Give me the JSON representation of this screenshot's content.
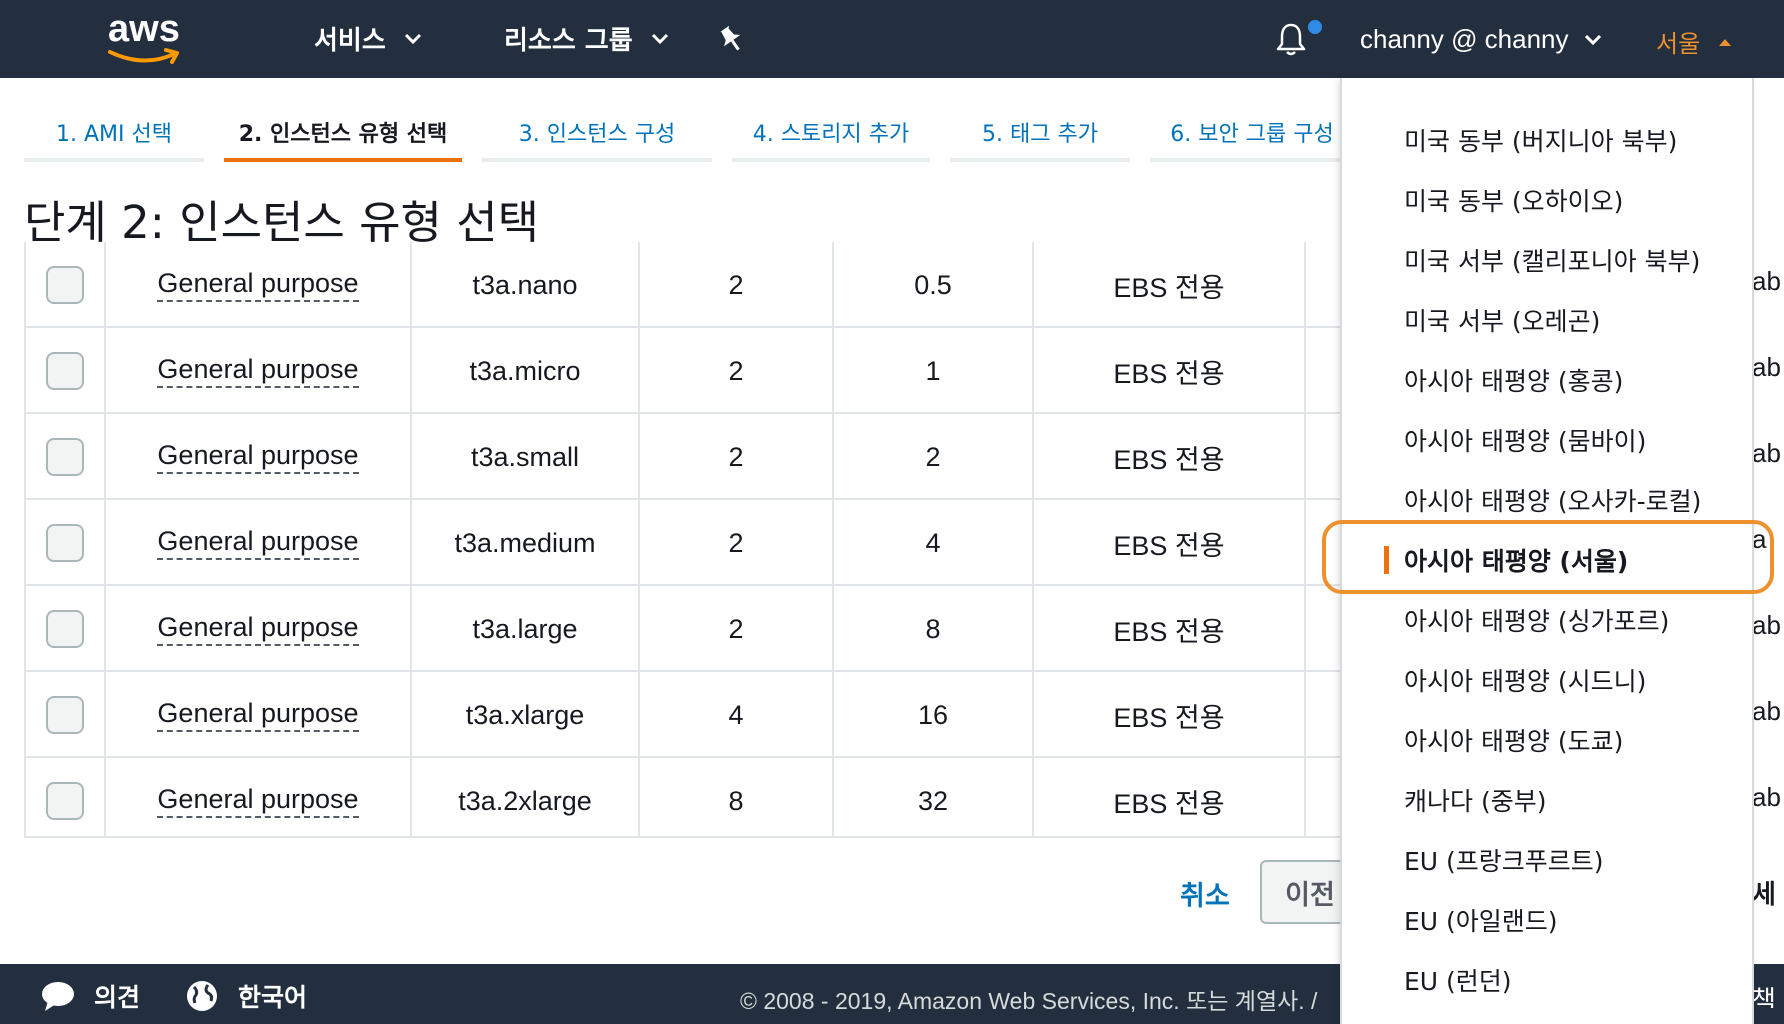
{
  "topnav": {
    "logo": "aws",
    "services_label": "서비스",
    "resource_groups_label": "리소스 그룹",
    "user_label": "channy @ channy",
    "region_label": "서울",
    "colors": {
      "background": "#232f3e",
      "region": "#ec912d",
      "notification_dot": "#2f8ce6"
    },
    "icons": [
      "chevron-down-icon",
      "pin-icon",
      "bell-icon",
      "chevron-up-icon"
    ]
  },
  "steps": [
    {
      "label": "1. AMI 선택"
    },
    {
      "label": "2. 인스턴스 유형 선택",
      "active": true
    },
    {
      "label": "3. 인스턴스 구성"
    },
    {
      "label": "4. 스토리지 추가"
    },
    {
      "label": "5. 태그 추가"
    },
    {
      "label": "6. 보안 그룹 구성"
    }
  ],
  "page_title": "단계 2: 인스턴스 유형 선택",
  "table": {
    "rows": [
      {
        "family": "General purpose",
        "type": "t3a.nano",
        "vcpus": "2",
        "memory": "0.5",
        "storage": "EBS 전용",
        "next": "ab"
      },
      {
        "family": "General purpose",
        "type": "t3a.micro",
        "vcpus": "2",
        "memory": "1",
        "storage": "EBS 전용",
        "next": "ab"
      },
      {
        "family": "General purpose",
        "type": "t3a.small",
        "vcpus": "2",
        "memory": "2",
        "storage": "EBS 전용",
        "next": "ab"
      },
      {
        "family": "General purpose",
        "type": "t3a.medium",
        "vcpus": "2",
        "memory": "4",
        "storage": "EBS 전용",
        "next": "a"
      },
      {
        "family": "General purpose",
        "type": "t3a.large",
        "vcpus": "2",
        "memory": "8",
        "storage": "EBS 전용",
        "next": "ab"
      },
      {
        "family": "General purpose",
        "type": "t3a.xlarge",
        "vcpus": "4",
        "memory": "16",
        "storage": "EBS 전용",
        "next": "ab"
      },
      {
        "family": "General purpose",
        "type": "t3a.2xlarge",
        "vcpus": "8",
        "memory": "32",
        "storage": "EBS 전용",
        "next": "ab"
      }
    ]
  },
  "actions": {
    "cancel_label": "취소",
    "previous_label": "이전",
    "next_label": "세"
  },
  "footer": {
    "feedback_label": "의견",
    "language_label": "한국어",
    "copyright": "© 2008 - 2019, Amazon Web Services, Inc. 또는 계열사. /",
    "trailing": "책"
  },
  "region_menu": {
    "items": [
      {
        "label": "미국 동부 (버지니아 북부)"
      },
      {
        "label": "미국 동부 (오하이오)"
      },
      {
        "label": "미국 서부 (캘리포니아 북부)"
      },
      {
        "label": "미국 서부 (오레곤)"
      },
      {
        "label": "아시아 태평양 (홍콩)"
      },
      {
        "label": "아시아 태평양 (뭄바이)"
      },
      {
        "label": "아시아 태평양 (오사카-로컬)"
      },
      {
        "label": "아시아 태평양 (서울)",
        "selected": true
      },
      {
        "label": "아시아 태평양 (싱가포르)"
      },
      {
        "label": "아시아 태평양 (시드니)"
      },
      {
        "label": "아시아 태평양 (도쿄)"
      },
      {
        "label": "캐나다 (중부)"
      },
      {
        "label": "EU (프랑크푸르트)"
      },
      {
        "label": "EU (아일랜드)"
      },
      {
        "label": "EU (런던)"
      }
    ],
    "highlight_color": "#ec912d"
  }
}
